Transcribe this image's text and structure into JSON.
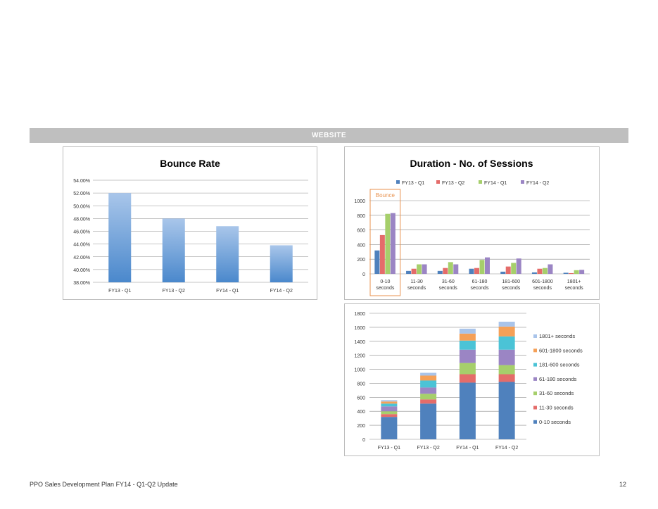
{
  "section": {
    "title": "WEBSITE"
  },
  "footer": {
    "text": "PPO Sales Development Plan FY14 - Q1-Q2 Update",
    "page": "12"
  },
  "chart_data": [
    {
      "type": "bar",
      "title": "Bounce Rate",
      "categories": [
        "FY13 - Q1",
        "FY13 - Q2",
        "FY14 - Q1",
        "FY14 - Q2"
      ],
      "values": [
        52.0,
        48.0,
        46.8,
        43.8
      ],
      "ylim": [
        38,
        54
      ],
      "yticks": [
        "38.00%",
        "40.00%",
        "42.00%",
        "44.00%",
        "46.00%",
        "48.00%",
        "50.00%",
        "52.00%",
        "54.00%"
      ],
      "grid": true,
      "color": "#5b9bd5"
    },
    {
      "type": "bar",
      "title": "Duration - No. of Sessions",
      "categories": [
        [
          "0-10",
          "seconds"
        ],
        [
          "11-30",
          "seconds"
        ],
        [
          "31-60",
          "seconds"
        ],
        [
          "61-180",
          "seconds"
        ],
        [
          "181-600",
          "seconds"
        ],
        [
          "601-1800",
          "seconds"
        ],
        [
          "1801+",
          "seconds"
        ]
      ],
      "series": [
        {
          "name": "FY13 - Q1",
          "color": "#4f81bd",
          "values": [
            320,
            40,
            40,
            70,
            30,
            20,
            15
          ]
        },
        {
          "name": "FY13 - Q2",
          "color": "#e46c6a",
          "values": [
            530,
            70,
            80,
            80,
            100,
            70,
            10
          ]
        },
        {
          "name": "FY14 - Q1",
          "color": "#a6cf6b",
          "values": [
            820,
            130,
            160,
            190,
            150,
            80,
            50
          ]
        },
        {
          "name": "FY14 - Q2",
          "color": "#9b85c4",
          "values": [
            830,
            130,
            130,
            225,
            210,
            130,
            55
          ]
        }
      ],
      "ylim": [
        0,
        1000
      ],
      "yticks": [
        "0",
        "200",
        "400",
        "600",
        "800",
        "1000"
      ],
      "legend": "top",
      "annotation": "Bounce",
      "annotation_color": "#e8914d"
    },
    {
      "type": "bar",
      "stacked": true,
      "categories": [
        "FY13 - Q1",
        "FY13 - Q2",
        "FY14 - Q1",
        "FY14 - Q2"
      ],
      "series": [
        {
          "name": "0-10 seconds",
          "color": "#4f81bd",
          "values": [
            320,
            510,
            810,
            820
          ]
        },
        {
          "name": "11-30 seconds",
          "color": "#e46c6a",
          "values": [
            40,
            60,
            120,
            110
          ]
        },
        {
          "name": "31-60 seconds",
          "color": "#a6cf6b",
          "values": [
            40,
            80,
            160,
            130
          ]
        },
        {
          "name": "61-180 seconds",
          "color": "#9b85c4",
          "values": [
            70,
            90,
            190,
            220
          ]
        },
        {
          "name": "181-600 seconds",
          "color": "#4bc3d6",
          "values": [
            40,
            100,
            130,
            190
          ]
        },
        {
          "name": "601-1800 seconds",
          "color": "#f5a057",
          "values": [
            30,
            70,
            100,
            140
          ]
        },
        {
          "name": "1801+ seconds",
          "color": "#a9c4ea",
          "values": [
            20,
            40,
            70,
            70
          ]
        }
      ],
      "ylim": [
        0,
        1800
      ],
      "yticks": [
        "0",
        "200",
        "400",
        "600",
        "800",
        "1000",
        "1200",
        "1400",
        "1600",
        "1800"
      ],
      "legend": "right"
    }
  ]
}
